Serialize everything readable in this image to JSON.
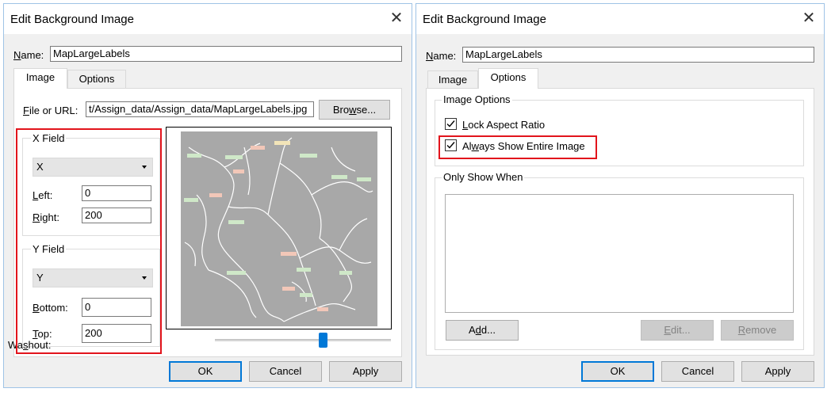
{
  "left_dialog": {
    "title": "Edit Background Image",
    "name_label_u": "N",
    "name_label_rest": "ame:",
    "name_value": "MapLargeLabels",
    "tabs": [
      "Image",
      "Options"
    ],
    "file_label_u": "F",
    "file_label_rest": "ile or URL:",
    "file_value": "t/Assign_data/Assign_data/MapLargeLabels.jpg",
    "browse_pre": "Bro",
    "browse_u": "w",
    "browse_post": "se...",
    "x_field": {
      "title": "X Field",
      "selected": "X",
      "first_label_u": "L",
      "first_label_rest": "eft:",
      "first_value": "0",
      "second_label_u": "R",
      "second_label_rest": "ight:",
      "second_value": "200"
    },
    "y_field": {
      "title": "Y Field",
      "selected": "Y",
      "first_label_u": "B",
      "first_label_rest": "ottom:",
      "first_value": "0",
      "second_label_u": "T",
      "second_label_rest": "op:",
      "second_value": "200"
    },
    "washout_pre": "Wa",
    "washout_u": "s",
    "washout_post": "hout:",
    "washout_level_percent": 62,
    "buttons": {
      "ok": "OK",
      "cancel": "Cancel",
      "apply": "Apply"
    }
  },
  "right_dialog": {
    "title": "Edit Background Image",
    "name_label_u": "N",
    "name_label_rest": "ame:",
    "name_value": "MapLargeLabels",
    "tabs": [
      "Image",
      "Options"
    ],
    "image_options_title": "Image Options",
    "lock_aspect_u": "L",
    "lock_aspect_rest": "ock Aspect Ratio",
    "lock_aspect_checked": true,
    "always_show_pre": "Al",
    "always_show_u": "w",
    "always_show_post": "ays Show Entire Image",
    "always_show_checked": true,
    "only_show_when_title": "Only Show When",
    "add_pre": "A",
    "add_u": "d",
    "add_post": "d...",
    "edit_u": "E",
    "edit_rest": "dit...",
    "remove_u": "R",
    "remove_rest": "emove",
    "buttons": {
      "ok": "OK",
      "cancel": "Cancel",
      "apply": "Apply"
    }
  },
  "colors": {
    "highlight_red": "#e2141c",
    "accent_blue": "#0078d7",
    "dialog_bg": "#f0f0f0",
    "map_bg": "#a8a8a8"
  }
}
